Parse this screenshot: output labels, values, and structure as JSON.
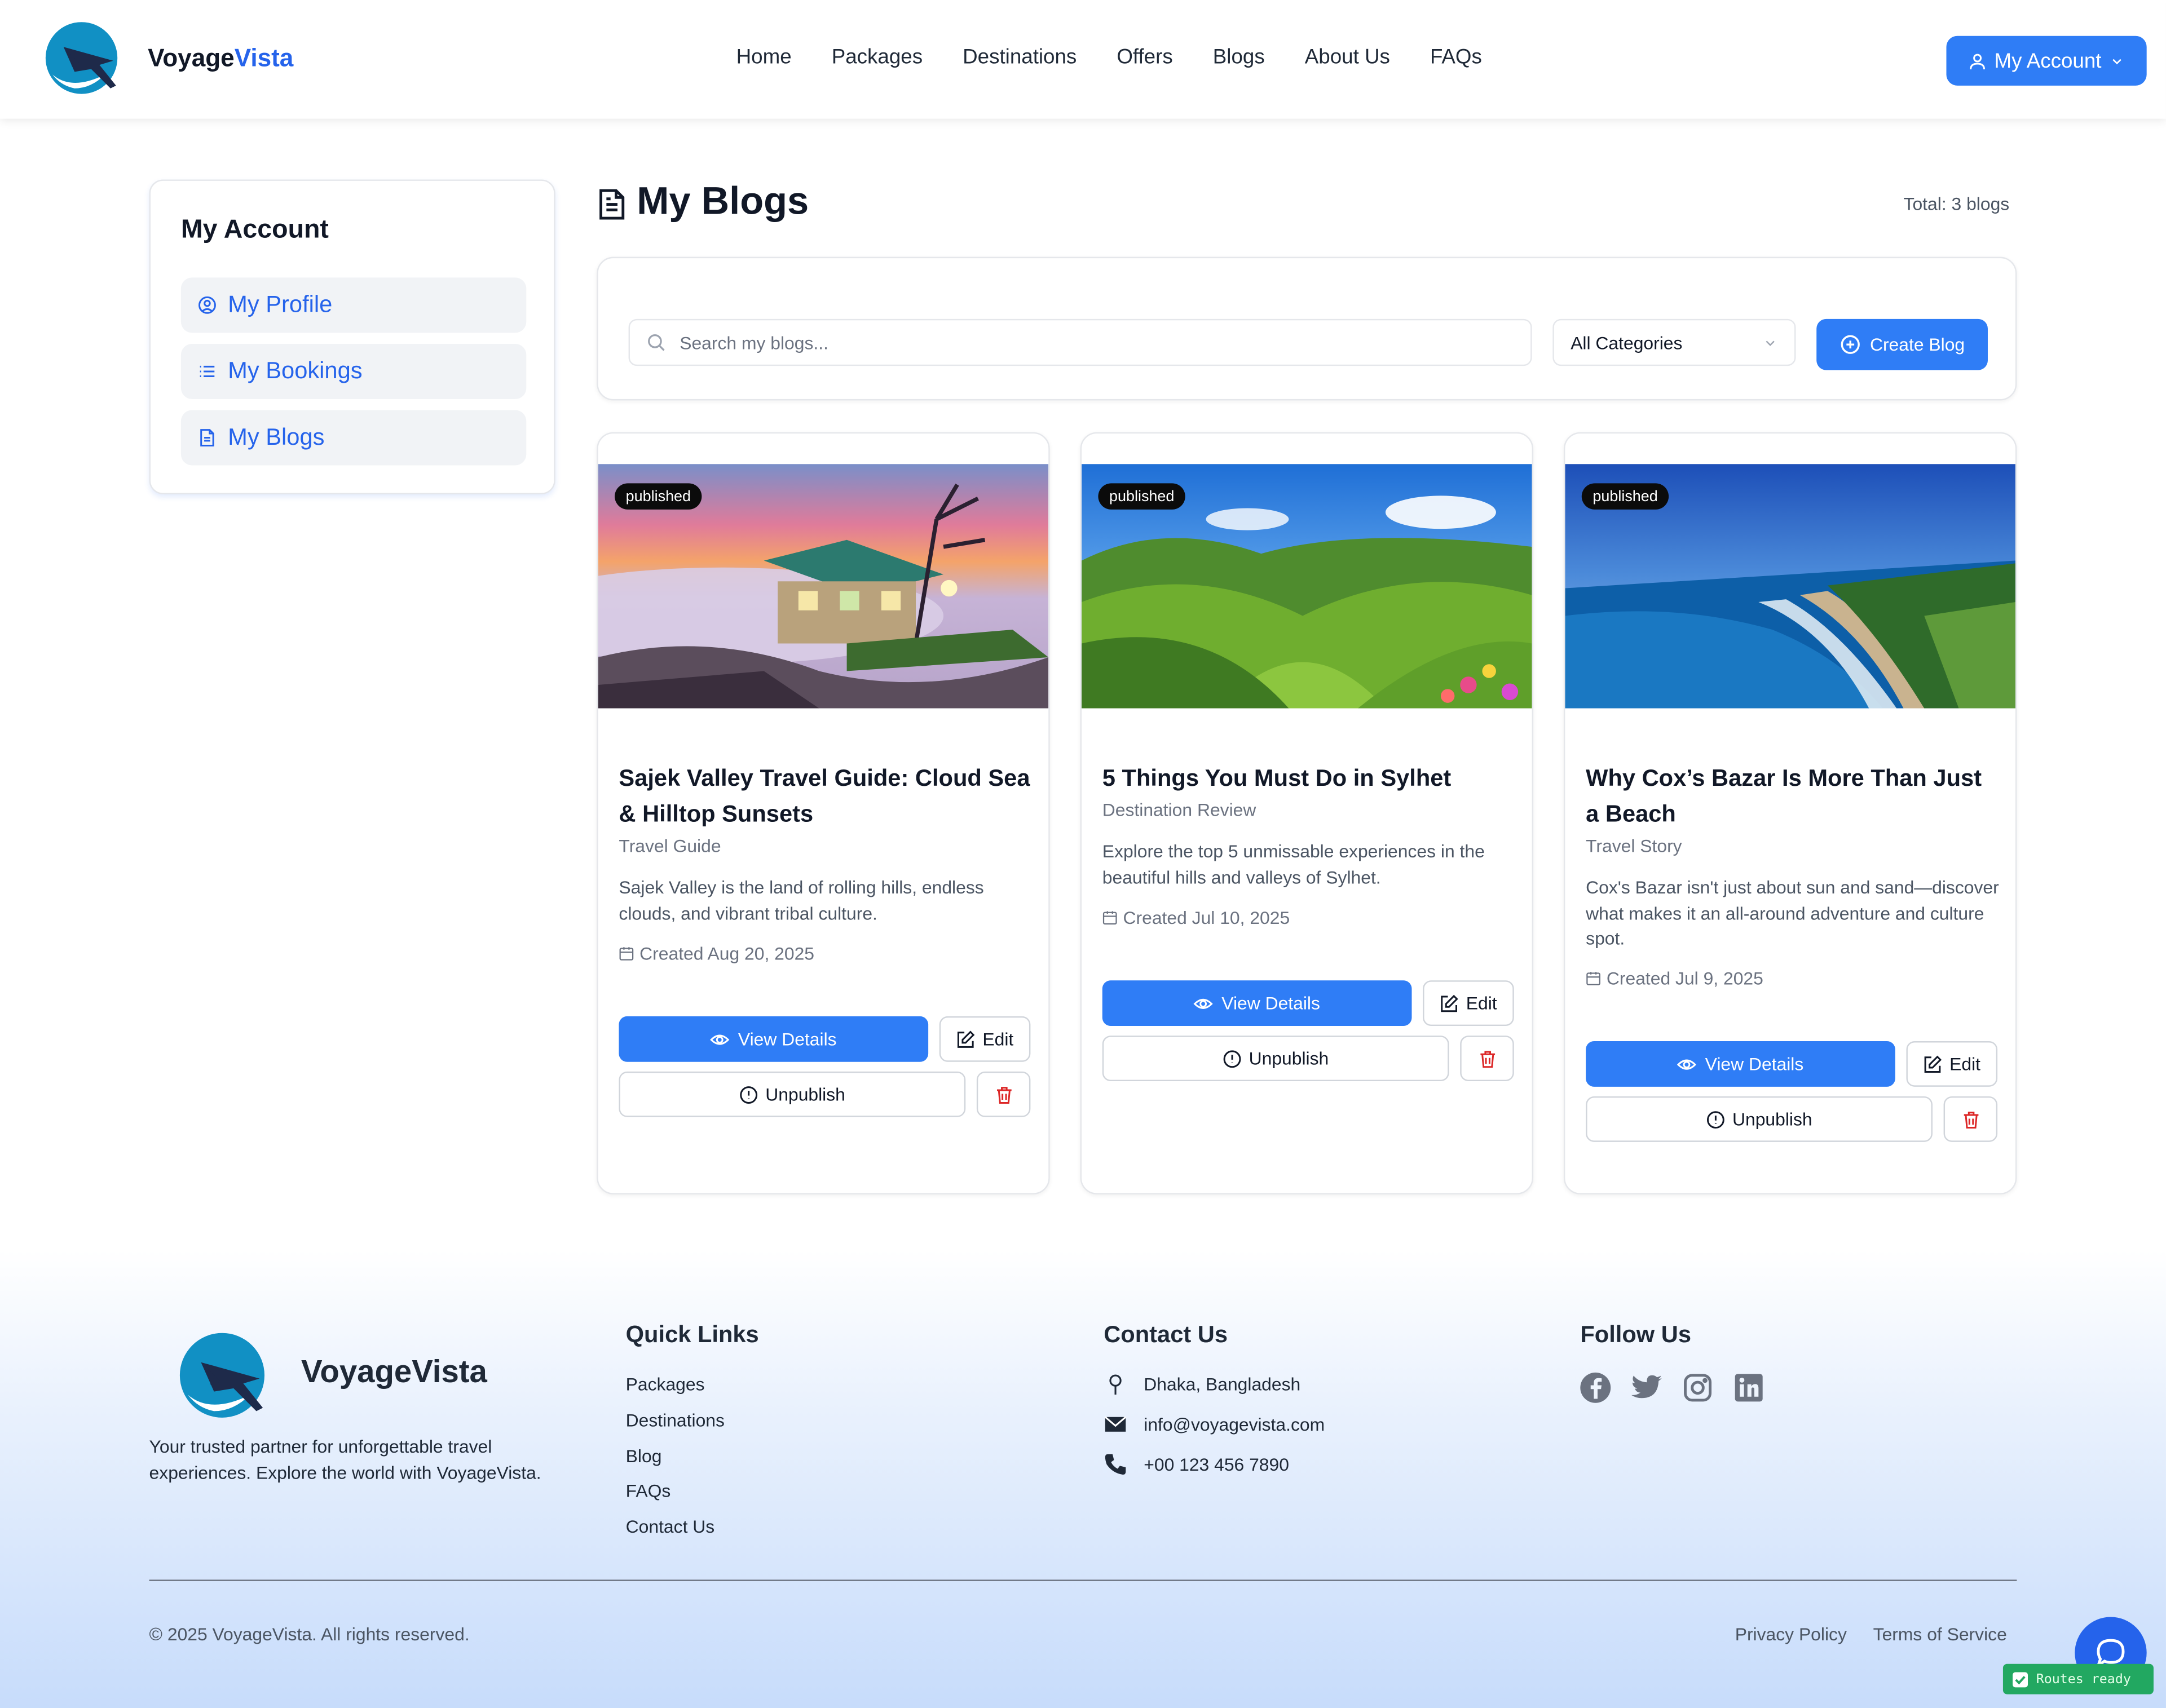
{
  "header": {
    "brand_part1": "Voyage",
    "brand_part2": "Vista",
    "nav": [
      "Home",
      "Packages",
      "Destinations",
      "Offers",
      "Blogs",
      "About Us",
      "FAQs"
    ],
    "account_button": "My Account"
  },
  "sidebar": {
    "title": "My Account",
    "items": [
      {
        "label": "My Profile",
        "icon": "user-circle-icon"
      },
      {
        "label": "My Bookings",
        "icon": "list-icon"
      },
      {
        "label": "My Blogs",
        "icon": "file-text-icon"
      }
    ]
  },
  "main": {
    "title": "My Blogs",
    "total": "Total: 3 blogs",
    "search_placeholder": "Search my blogs...",
    "category_select": "All Categories",
    "create_button": "Create Blog"
  },
  "cards": [
    {
      "status": "published",
      "title": "Sajek Valley Travel Guide: Cloud Sea & Hilltop Sunsets",
      "category": "Travel Guide",
      "excerpt": "Sajek Valley is the land of rolling hills, endless clouds, and vibrant tribal culture.",
      "created": "Created Aug 20, 2025",
      "view_label": "View Details",
      "edit_label": "Edit",
      "unpublish_label": "Unpublish"
    },
    {
      "status": "published",
      "title": "5 Things You Must Do in Sylhet",
      "category": "Destination Review",
      "excerpt": "Explore the top 5 unmissable experiences in the beautiful hills and valleys of Sylhet.",
      "created": "Created Jul 10, 2025",
      "view_label": "View Details",
      "edit_label": "Edit",
      "unpublish_label": "Unpublish"
    },
    {
      "status": "published",
      "title": "Why Cox’s Bazar Is More Than Just a Beach",
      "category": "Travel Story",
      "excerpt": "Cox's Bazar isn't just about sun and sand—discover what makes it an all-around adventure and culture spot.",
      "created": "Created Jul 9, 2025",
      "view_label": "View Details",
      "edit_label": "Edit",
      "unpublish_label": "Unpublish"
    }
  ],
  "footer": {
    "brand": "VoyageVista",
    "tagline": "Your trusted partner for unforgettable travel experiences. Explore the world with VoyageVista.",
    "quick_links_title": "Quick Links",
    "quick_links": [
      "Packages",
      "Destinations",
      "Blog",
      "FAQs",
      "Contact Us"
    ],
    "contact_title": "Contact Us",
    "contact": {
      "address": "Dhaka, Bangladesh",
      "email": "info@voyagevista.com",
      "phone": "+00 123 456 7890"
    },
    "follow_title": "Follow Us",
    "social": [
      "facebook-icon",
      "twitter-icon",
      "instagram-icon",
      "linkedin-icon"
    ],
    "copyright": "© 2025 VoyageVista. All rights reserved.",
    "privacy": "Privacy Policy",
    "terms": "Terms of Service"
  },
  "status_indicator": "Routes ready",
  "colors": {
    "primary": "#2f7df6",
    "brand_accent": "#2563eb",
    "danger": "#dc2626",
    "badge": "#0b0b0b"
  }
}
